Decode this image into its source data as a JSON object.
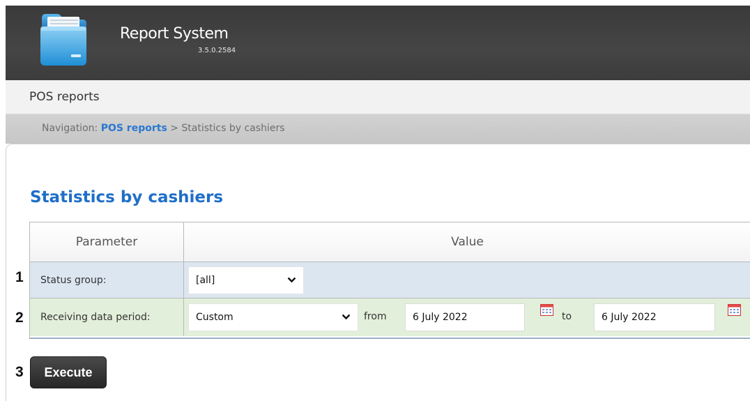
{
  "app": {
    "title": "Report System",
    "version": "3.5.0.2584",
    "logo_icon": "folder-icon"
  },
  "section": {
    "title": "POS reports"
  },
  "breadcrumb": {
    "prefix": "Navigation:",
    "link": "POS reports",
    "separator": ">",
    "current": "Statistics by cashiers"
  },
  "page": {
    "title": "Statistics by cashiers"
  },
  "table": {
    "headers": {
      "parameter": "Parameter",
      "value": "Value"
    },
    "rows": [
      {
        "number": "1",
        "label": "Status group:",
        "select_value": "[all]",
        "row_color": "#dce6f1"
      },
      {
        "number": "2",
        "label": "Receiving data period:",
        "select_value": "Custom",
        "from_label": "from",
        "from_date": "6 July 2022",
        "to_label": "to",
        "to_date": "6 July 2022",
        "row_color": "#e2efda"
      }
    ]
  },
  "execute": {
    "number": "3",
    "label": "Execute"
  },
  "icons": {
    "dropdown": "chevron-down-icon",
    "calendar": "calendar-icon"
  },
  "colors": {
    "header_bg": "#3f3f3f",
    "link": "#2a78d0",
    "title": "#1f6fc9",
    "button_bg": "#2e2e2e"
  }
}
